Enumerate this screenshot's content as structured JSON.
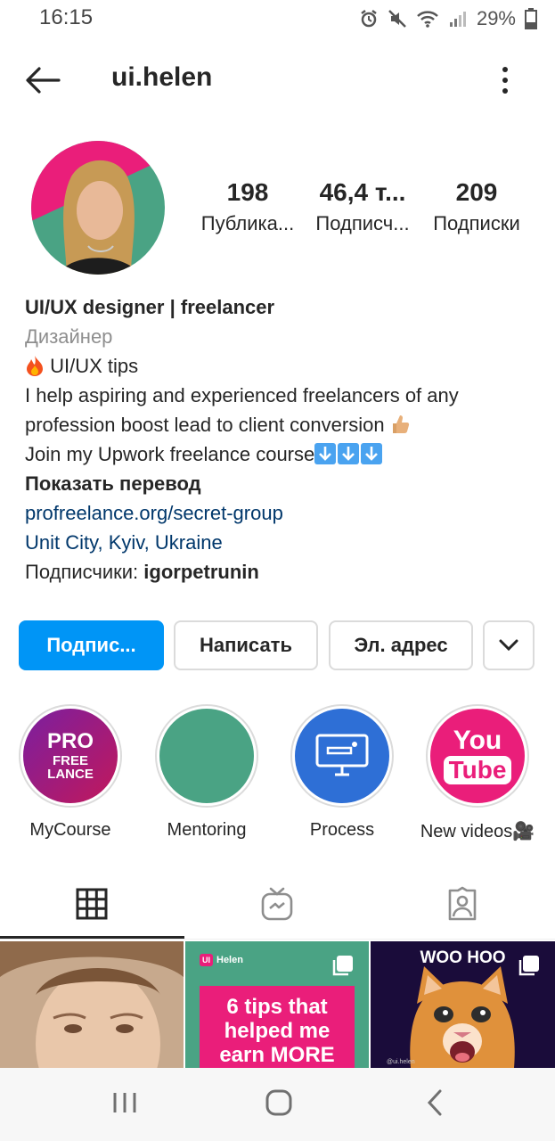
{
  "status_bar": {
    "time": "16:15",
    "battery": "29%",
    "icons": [
      "alarm-icon",
      "mute-icon",
      "wifi-icon",
      "signal-icon",
      "battery-icon"
    ]
  },
  "header": {
    "username": "ui.helen",
    "back_icon": "arrow-left-icon",
    "more_icon": "more-vertical-icon"
  },
  "profile": {
    "stats": [
      {
        "number": "198",
        "label": "Публика..."
      },
      {
        "number": "46,4 т...",
        "label": "Подписч..."
      },
      {
        "number": "209",
        "label": "Подписки"
      }
    ],
    "bio": {
      "name": "UI/UX designer | freelancer",
      "category": "Дизайнер",
      "tips_line": "UI/UX tips",
      "description": "I help aspiring and experienced freelancers of any profession boost lead to client conversion",
      "course_line": "Join my Upwork freelance course",
      "translate": "Показать перевод",
      "link": "profreelance.org/secret-group",
      "location": "Unit City, Kyiv, Ukraine",
      "followers_prefix": "Подписчики:",
      "followers_name": "igorpetrunin"
    }
  },
  "actions": {
    "follow": "Подпис...",
    "message": "Написать",
    "email": "Эл. адрес"
  },
  "highlights": [
    {
      "label": "MyCourse",
      "line1": "PRO",
      "line2": "FREE",
      "line3": "LANCE"
    },
    {
      "label": "Mentoring"
    },
    {
      "label": "Process"
    },
    {
      "label": "New videos🎥",
      "line1": "You",
      "line2": "Tube"
    }
  ],
  "grid": [
    {
      "type": "photo"
    },
    {
      "type": "post",
      "brand": "Helen",
      "brand_badge": "UI",
      "text": "6 tips that helped me earn MORE"
    },
    {
      "type": "post",
      "text": "WOO HOO",
      "watermark": "@ui.helen"
    }
  ],
  "colors": {
    "accent": "#0095f6",
    "link": "#00376b",
    "teal": "#4aa384",
    "pink": "#ea1e7a",
    "cat_bg": "#1a0c3a"
  }
}
